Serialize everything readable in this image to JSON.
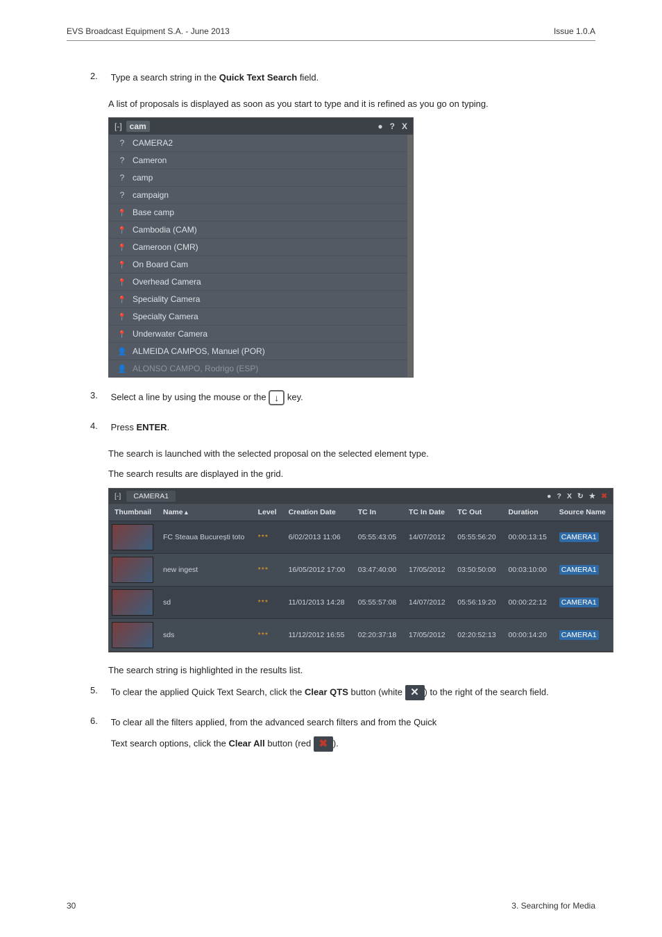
{
  "header": {
    "left": "EVS Broadcast Equipment S.A.  -  June 2013",
    "right": "Issue 1.0.A"
  },
  "steps": {
    "s2": {
      "num": "2.",
      "line": "Type a search string in the ",
      "bold": "Quick Text Search",
      "line_end": " field.",
      "sub": "A list of proposals is displayed as soon as you start to type and it is refined as you go on typing."
    },
    "s3": {
      "num": "3.",
      "line_a": "Select a line by using the mouse or the ",
      "line_b": " key."
    },
    "s4": {
      "num": "4.",
      "line": "Press ",
      "bold": "ENTER",
      "line_end": ".",
      "sub1": "The search is launched with the selected proposal on the selected element type.",
      "sub2": "The search results are displayed in the grid."
    },
    "post_grid": "The search string is highlighted in the results list.",
    "s5": {
      "num": "5.",
      "line_a": "To clear the applied Quick Text Search, click the ",
      "bold": "Clear QTS",
      "line_b": " button (white ",
      "line_c": ") to the right of the search field."
    },
    "s6": {
      "num": "6.",
      "line_a": "To clear all the filters applied, from the advanced search filters and from the Quick",
      "line_b": "Text search options, click the ",
      "bold": "Clear All",
      "line_c": " button (red ",
      "line_d": ")."
    }
  },
  "shot1": {
    "search_term": "cam",
    "win_icons": [
      "●",
      "?",
      "X"
    ],
    "items": [
      {
        "glyph": "q",
        "label": "CAMERA2"
      },
      {
        "glyph": "q",
        "label": "Cameron"
      },
      {
        "glyph": "q",
        "label": "camp"
      },
      {
        "glyph": "q",
        "label": "campaign"
      },
      {
        "glyph": "pin",
        "label": "Base camp"
      },
      {
        "glyph": "pin",
        "label": "Cambodia (CAM)"
      },
      {
        "glyph": "pin",
        "label": "Cameroon (CMR)"
      },
      {
        "glyph": "pin",
        "label": "On Board Cam"
      },
      {
        "glyph": "pin",
        "label": "Overhead Camera"
      },
      {
        "glyph": "pin",
        "label": "Speciality Camera"
      },
      {
        "glyph": "pin",
        "label": "Specialty Camera"
      },
      {
        "glyph": "pin",
        "label": "Underwater Camera"
      },
      {
        "glyph": "person",
        "label": "ALMEIDA CAMPOS, Manuel (POR)"
      },
      {
        "glyph": "person",
        "label": "ALONSO CAMPO, Rodrigo (ESP)"
      }
    ]
  },
  "shot2": {
    "tab": "CAMERA1",
    "win_icons": [
      "●",
      "?",
      "X",
      "↻",
      "★",
      "✖"
    ],
    "columns": [
      "Thumbnail",
      "Name",
      "Level",
      "Creation Date",
      "TC In",
      "TC In Date",
      "TC Out",
      "Duration",
      "Source Name"
    ],
    "sort_col": "Name",
    "rows": [
      {
        "name": "FC Steaua București toto",
        "level": "***",
        "cdate": "6/02/2013 11:06",
        "tcin": "05:55:43:05",
        "tcind": "14/07/2012",
        "tcout": "05:55:56:20",
        "dur": "00:00:13:15",
        "src": "CAMERA1"
      },
      {
        "name": "new ingest",
        "level": "***",
        "cdate": "16/05/2012 17:00",
        "tcin": "03:47:40:00",
        "tcind": "17/05/2012",
        "tcout": "03:50:50:00",
        "dur": "00:03:10:00",
        "src": "CAMERA1"
      },
      {
        "name": "sd",
        "level": "***",
        "cdate": "11/01/2013 14:28",
        "tcin": "05:55:57:08",
        "tcind": "14/07/2012",
        "tcout": "05:56:19:20",
        "dur": "00:00:22:12",
        "src": "CAMERA1"
      },
      {
        "name": "sds",
        "level": "***",
        "cdate": "11/12/2012 16:55",
        "tcin": "02:20:37:18",
        "tcind": "17/05/2012",
        "tcout": "02:20:52:13",
        "dur": "00:00:14:20",
        "src": "CAMERA1"
      }
    ]
  },
  "footer": {
    "left": "30",
    "right": "3. Searching for Media"
  }
}
